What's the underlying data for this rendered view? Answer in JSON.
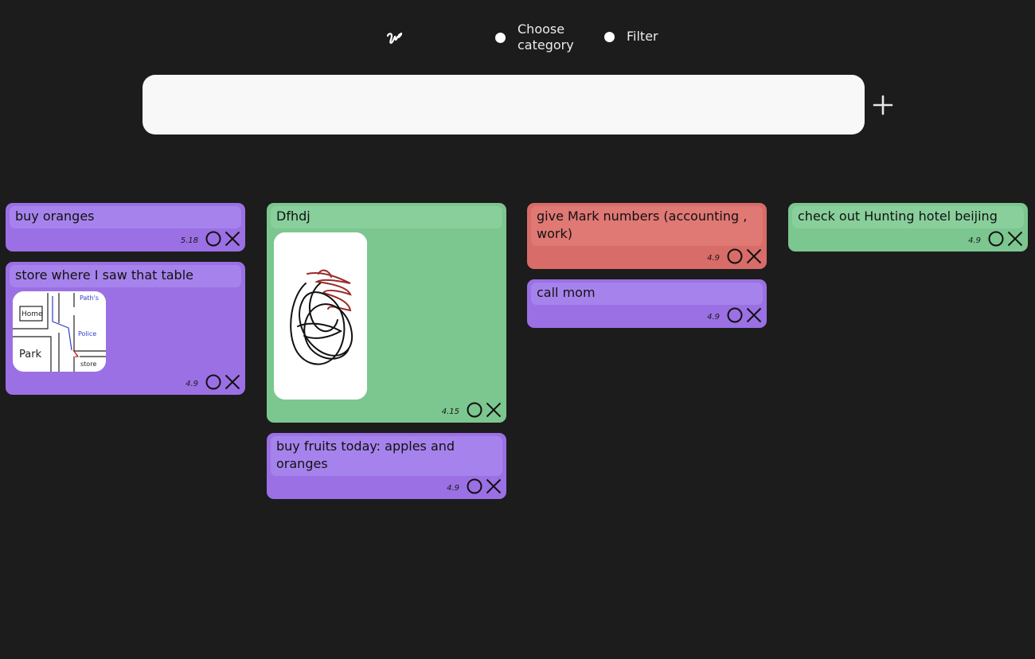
{
  "header": {
    "options": [
      {
        "label": "Choose category"
      },
      {
        "label": "Filter"
      }
    ]
  },
  "search": {
    "value": "",
    "placeholder": ""
  },
  "colors": {
    "purple": "#9b70e4",
    "green": "#7cc690",
    "red": "#d86c69",
    "background": "#1c1c1c"
  },
  "columns": [
    [
      {
        "title": "buy oranges",
        "date": "5.18",
        "color": "purple"
      },
      {
        "title": "store where I saw that table",
        "date": "4.9",
        "color": "purple",
        "image": "map-sketch"
      }
    ],
    [
      {
        "title": "Dfhdj",
        "date": "4.15",
        "color": "green",
        "image": "scribble-drawing"
      },
      {
        "title": "buy fruits today: apples and oranges",
        "date": "4.9",
        "color": "purple"
      }
    ],
    [
      {
        "title": "give Mark numbers (accounting , work)",
        "date": "4.9",
        "color": "red"
      },
      {
        "title": "call mom",
        "date": "4.9",
        "color": "purple"
      }
    ],
    [
      {
        "title": "check out Hunting hotel beijing",
        "date": "4.9",
        "color": "green"
      }
    ]
  ],
  "map_labels": {
    "home": "Home",
    "paths": "Path's",
    "police": "Police",
    "park": "Park",
    "store": "store"
  },
  "icons": {
    "logo": "swirl-logo-icon",
    "add": "plus-icon",
    "complete": "circle-icon",
    "delete": "close-icon"
  }
}
